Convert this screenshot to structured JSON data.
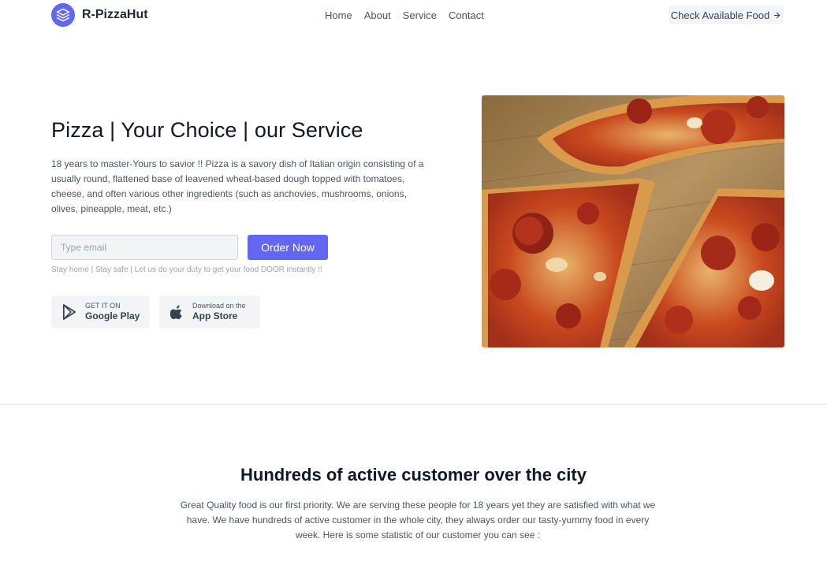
{
  "nav": {
    "brand": "R-PizzaHut",
    "links": [
      "Home",
      "About",
      "Service",
      "Contact"
    ],
    "cta": "Check Available Food"
  },
  "hero": {
    "title": "Pizza | Your Choice | our Service",
    "description": "18 years to master-Yours to savior !! Pizza is a savory dish of Italian origin consisting of a usually round, flattened base of leavened wheat-based dough topped with tomatoes, cheese, and often various other ingredients (such as anchovies, mushrooms, onions, olives, pineapple, meat, etc.)",
    "email_placeholder": "Type email",
    "order_button": "Order Now",
    "tagline": "Stay home | Stay safe | Let us do your duty to get your food DOOR instantly !!",
    "google_play": {
      "small": "GET IT ON",
      "big": "Google Play"
    },
    "app_store": {
      "small": "Download on the",
      "big": "App Store"
    }
  },
  "stats": {
    "title": "Hundreds of active customer over the city",
    "text": "Great Quality food is our first priority. We are serving these people for 18 years yet they are satisfied with what we have. We have hundreds of active customer in the whole city, they always order our tasty-yummy food in every week. Here is some statistic of our customer you can see :"
  },
  "colors": {
    "accent": "#6366f1",
    "muted": "#f3f4f6"
  }
}
